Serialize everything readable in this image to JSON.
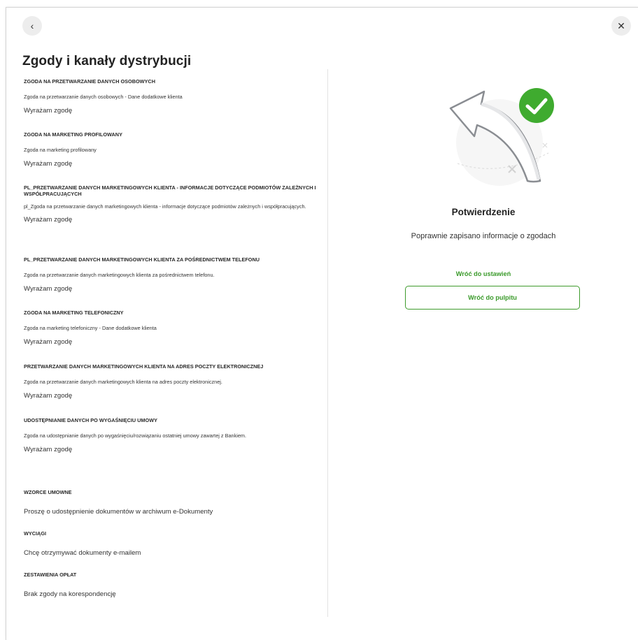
{
  "header": {
    "title": "Zgody i kanały dystrybucji",
    "back_icon": "chevron-left-icon",
    "close_icon": "close-icon"
  },
  "consents": [
    {
      "heading": "ZGODA NA PRZETWARZANIE DANYCH OSOBOWYCH",
      "description": "Zgoda na przetwarzanie danych osobowych - Dane dodatkowe klienta",
      "value": "Wyrażam zgodę"
    },
    {
      "heading": "ZGODA NA MARKETING PROFILOWANY",
      "description": "Zgoda na marketing profilowany",
      "value": "Wyrażam zgodę"
    },
    {
      "heading": "PL_PRZETWARZANIE DANYCH MARKETINGOWYCH KLIENTA - INFORMACJE DOTYCZĄCE PODMIOTÓW ZALEŻNYCH I WSPÓŁPRACUJĄCYCH",
      "description": "pl_Zgoda na przetwarzanie danych marketingowych klienta - informacje dotyczące podmiotów zależnych i współpracujących.",
      "value": "Wyrażam zgodę"
    },
    {
      "heading": "PL_PRZETWARZANIE DANYCH MARKETINGOWYCH KLIENTA ZA POŚREDNICTWEM TELEFONU",
      "description": "Zgoda na przetwarzanie danych marketingowych klienta za pośrednictwem telefonu.",
      "value": "Wyrażam zgodę"
    },
    {
      "heading": "ZGODA NA MARKETING TELEFONICZNY",
      "description": "Zgoda na marketing telefoniczny - Dane dodatkowe klienta",
      "value": "Wyrażam zgodę"
    },
    {
      "heading": "PRZETWARZANIE DANYCH MARKETINGOWYCH KLIENTA NA ADRES POCZTY ELEKTRONICZNEJ",
      "description": "Zgoda na przetwarzanie danych marketingowych klienta na adres poczty elektronicznej.",
      "value": "Wyrażam zgodę"
    },
    {
      "heading": "UDOSTĘPNIANIE DANYCH PO WYGAŚNIĘCIU UMOWY",
      "description": "Zgoda na udostępnianie danych po wygaśnięciu/rozwiązaniu ostatniej umowy zawartej z Bankiem.",
      "value": "Wyrażam zgodę"
    }
  ],
  "channels": [
    {
      "heading": "WZORCE UMOWNE",
      "value": "Proszę o udostępnienie dokumentów w archiwum e-Dokumenty"
    },
    {
      "heading": "WYCIĄGI",
      "value": "Chcę otrzymywać dokumenty e-mailem"
    },
    {
      "heading": "ZESTAWIENIA OPŁAT",
      "value": "Brak zgody na korespondencję"
    }
  ],
  "confirmation": {
    "illustration_icon": "success-arrow-check-icon",
    "title": "Potwierdzenie",
    "message": "Poprawnie zapisano informacje o zgodach",
    "back_settings_label": "Wróć do ustawień",
    "back_dashboard_label": "Wróć do pulpitu"
  },
  "colors": {
    "accent": "#3a9a2a",
    "check_circle": "#3fab2f",
    "divider": "#e2e2e2"
  }
}
